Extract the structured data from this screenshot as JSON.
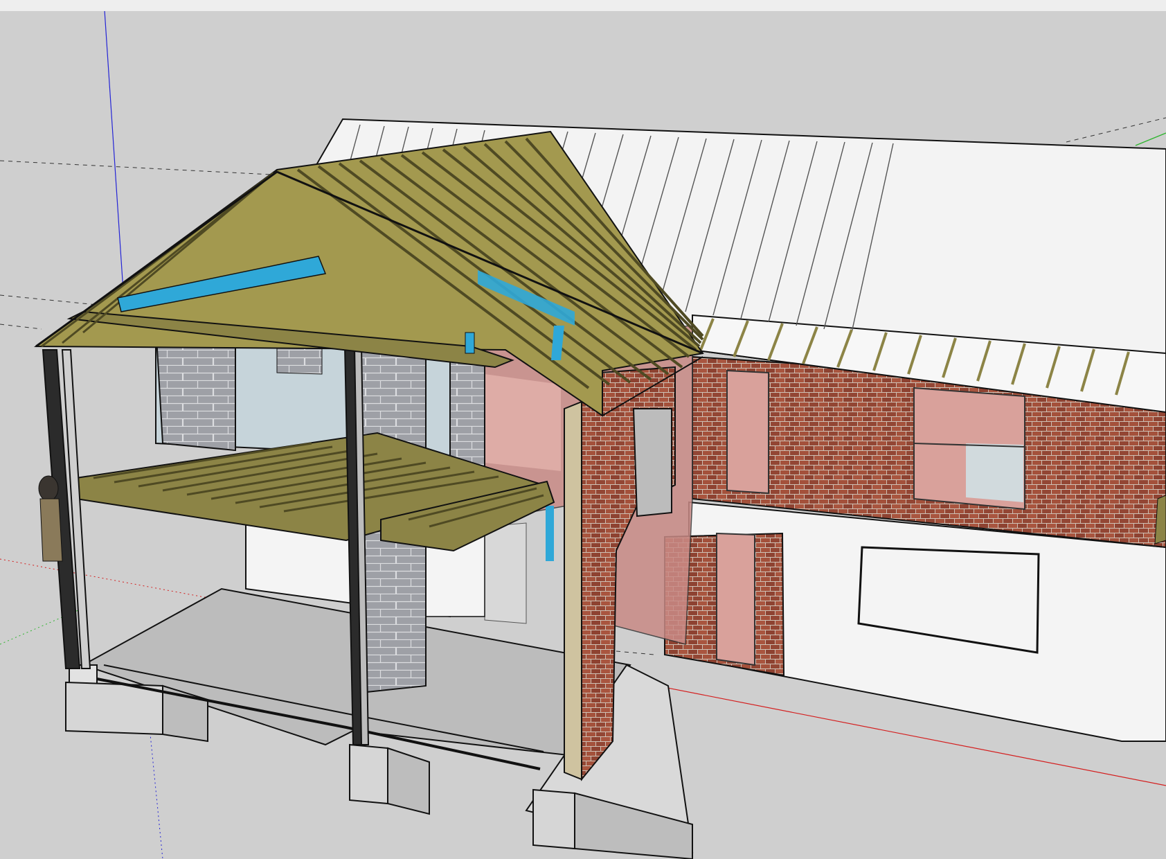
{
  "app": {
    "title": ""
  },
  "viewport": {
    "model": "house-section",
    "colors": {
      "background": "#cfcfcf",
      "ground": "#c8c8c8",
      "red_axis": "#d41e1e",
      "green_axis": "#2fb52f",
      "blue_axis": "#2424d6",
      "timber": "#8c8446",
      "timber_dark": "#4f4a23",
      "brick": "#9b4a36",
      "block": "#9ea0a6",
      "render": "#f4f4f4",
      "glass": "#c98a86",
      "steel": "#2fa8d8",
      "concrete": "#d9d9d9",
      "roof_white": "#f3f3f3"
    }
  }
}
